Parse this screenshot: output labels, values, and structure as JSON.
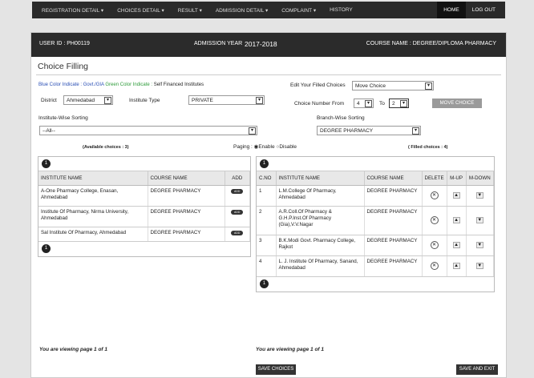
{
  "nav": {
    "items": [
      "REGISTRATION DETAIL ▾",
      "CHOICES DETAIL ▾",
      "RESULT ▾",
      "ADMISSION DETAIL ▾",
      "COMPLAINT ▾",
      "HISTORY"
    ],
    "home": "HOME",
    "logout": "LOG OUT"
  },
  "header": {
    "user_id": "USER ID : PH00119",
    "admission_label": "ADMISSION YEAR",
    "admission_year": "2017-2018",
    "course": "COURSE NAME : DEGREE/DIPLOMA PHARMACY"
  },
  "page_title": "Choice Filling",
  "legend_blue": "Blue Color Indicate : Govt./GIA",
  "legend_green": "Green Color Indicate :",
  "legend_self": "Self Financed Institutes",
  "filters": {
    "district_label": "District",
    "district_value": "Ahmedabad",
    "institute_type_label": "Institute Type",
    "institute_type_value": "PRIVATE",
    "edit_label": "Edit Your Filled Choices",
    "edit_value": "Move Choice",
    "choice_from_label": "Choice Number From",
    "choice_from_value": "4",
    "to_label": "To",
    "to_value": "2",
    "move_button": "MOVE CHOICE",
    "inst_sort_label": "Institute-Wise Sorting",
    "inst_sort_value": "--All--",
    "branch_sort_label": "Branch-Wise Sorting",
    "branch_sort_value": "DEGREE PHARMACY"
  },
  "available_count": "(Available choices : 3)",
  "paging_label": "Paging :",
  "paging_enable": "Enable",
  "paging_disable": "Disable",
  "filled_count": "( Filled choices : 4)",
  "available": {
    "page": "1",
    "columns": [
      "INSTITUTE NAME",
      "COURSE NAME",
      "ADD"
    ],
    "add_label": "ADD",
    "rows": [
      {
        "institute": "A-One Pharmacy College, Enasan, Ahmedabad",
        "course": "DEGREE PHARMACY"
      },
      {
        "institute": "Institute Of Pharmacy, Nirma University, Ahmedabad",
        "course": "DEGREE PHARMACY"
      },
      {
        "institute": "Sal Institute Of Pharmacy, Ahmedabad",
        "course": "DEGREE PHARMACY"
      }
    ]
  },
  "filled": {
    "page": "1",
    "columns": [
      "C.NO",
      "INSTITUTE NAME",
      "COURSE NAME",
      "DELETE",
      "M-UP",
      "M-DOWN"
    ],
    "rows": [
      {
        "no": "1",
        "institute": "L.M.College Of Pharmacy, Ahmedabad",
        "course": "DEGREE PHARMACY"
      },
      {
        "no": "2",
        "institute": "A.R.Coll.Of Pharmacy & G.H.P.Inst.Of Pharmacy (Gia),V.V.Nagar",
        "course": "DEGREE PHARMACY"
      },
      {
        "no": "3",
        "institute": "B.K.Modi Govt. Pharmacy College, Rajkot",
        "course": "DEGREE PHARMACY"
      },
      {
        "no": "4",
        "institute": "L. J. Institute Of Pharmacy, Sanand, Ahmedabad",
        "course": "DEGREE PHARMACY"
      }
    ]
  },
  "viewing_left": "You are viewing page 1 of 1",
  "viewing_right": "You are viewing page 1 of 1",
  "save_choices": "SAVE CHOICES",
  "save_exit": "SAVE AND EXIT"
}
